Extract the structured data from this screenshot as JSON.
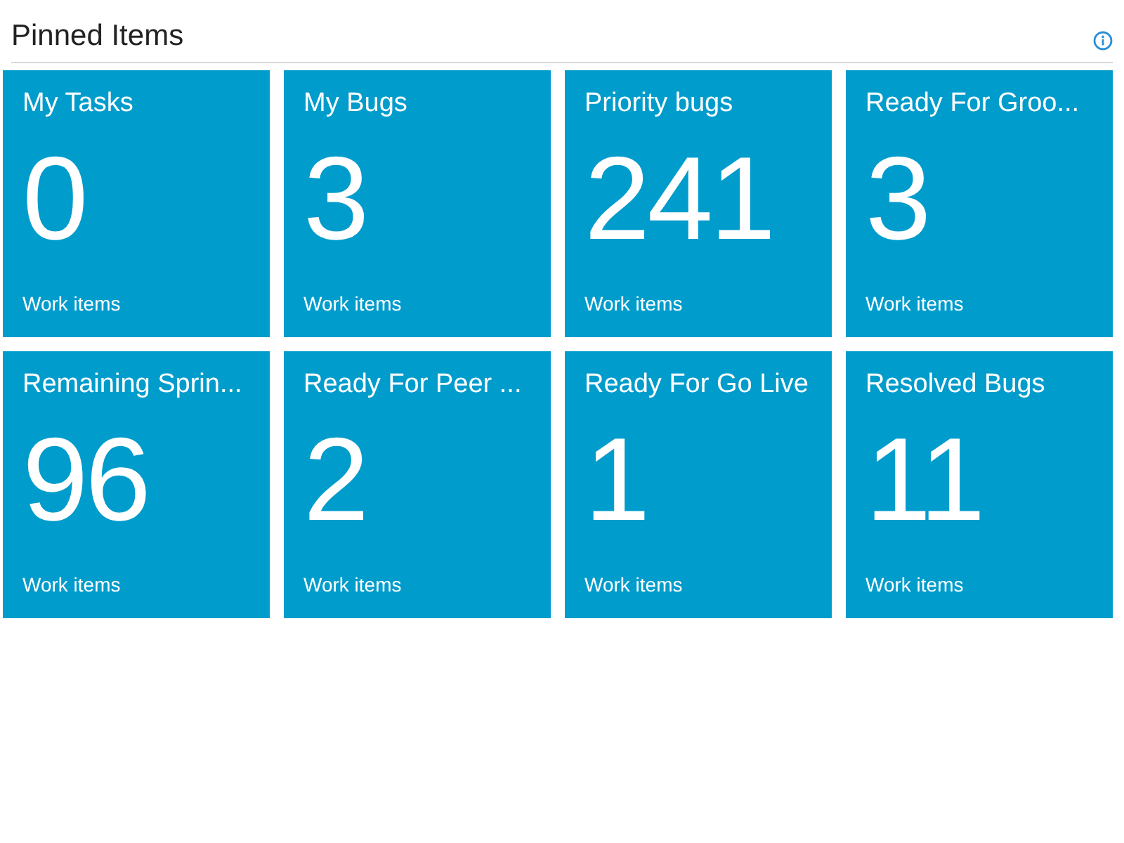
{
  "header": {
    "title": "Pinned Items"
  },
  "tiles": [
    {
      "title": "My Tasks",
      "count": "0",
      "caption": "Work items"
    },
    {
      "title": "My Bugs",
      "count": "3",
      "caption": "Work items"
    },
    {
      "title": "Priority bugs",
      "count": "241",
      "caption": "Work items"
    },
    {
      "title": "Ready For Groo...",
      "count": "3",
      "caption": "Work items"
    },
    {
      "title": "Remaining Sprin...",
      "count": "96",
      "caption": "Work items"
    },
    {
      "title": "Ready For Peer ...",
      "count": "2",
      "caption": "Work items"
    },
    {
      "title": "Ready For Go Live",
      "count": "1",
      "caption": "Work items"
    },
    {
      "title": "Resolved Bugs",
      "count": "11",
      "caption": "Work items"
    }
  ]
}
